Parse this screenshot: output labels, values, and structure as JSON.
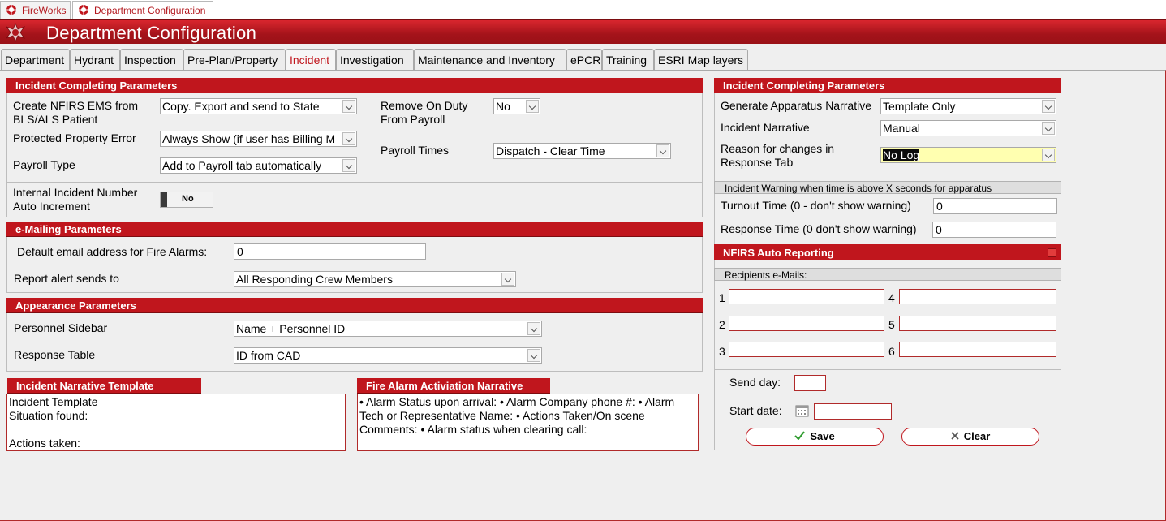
{
  "doc_tabs": [
    {
      "label": "FireWorks"
    },
    {
      "label": "Department Configuration"
    }
  ],
  "header": {
    "title": "Department Configuration"
  },
  "tabs": [
    {
      "label": "Department"
    },
    {
      "label": "Hydrant"
    },
    {
      "label": "Inspection"
    },
    {
      "label": "Pre-Plan/Property"
    },
    {
      "label": "Incident"
    },
    {
      "label": "Investigation"
    },
    {
      "label": "Maintenance and Inventory"
    },
    {
      "label": "ePCR"
    },
    {
      "label": "Training"
    },
    {
      "label": "ESRI Map layers"
    }
  ],
  "incident_params": {
    "title": "Incident Completing Parameters",
    "nfirs_ems_label": "Create NFIRS EMS from BLS/ALS Patient",
    "nfirs_ems_value": "Copy. Export and send to State",
    "protected_label": "Protected Property Error",
    "protected_value": "Always Show (if user has Billing M",
    "payroll_type_label": "Payroll Type",
    "payroll_type_value": "Add to Payroll tab automatically",
    "remove_on_duty_label": "Remove On Duty From Payroll",
    "remove_on_duty_value": "No",
    "payroll_times_label": "Payroll Times",
    "payroll_times_value": "Dispatch - Clear Time",
    "internal_number_label": "Internal Incident Number Auto Increment",
    "internal_number_value": "No"
  },
  "email_params": {
    "title": "e-Mailing Parameters",
    "default_email_label": "Default email address for Fire Alarms:",
    "default_email_value": "0",
    "report_alert_label": "Report alert sends to",
    "report_alert_value": "All Responding Crew Members"
  },
  "appearance_params": {
    "title": "Appearance Parameters",
    "sidebar_label": "Personnel Sidebar",
    "sidebar_value": "Name + Personnel ID",
    "response_table_label": "Response Table",
    "response_table_value": "ID from CAD"
  },
  "narrative_template": {
    "title": "Incident Narrative Template",
    "text": "Incident Template\nSituation found:\n\nActions taken:"
  },
  "fire_alarm_narrative": {
    "title": "Fire Alarm Activiation Narrative",
    "text": "• Alarm Status upon arrival: • Alarm Company phone #: • Alarm Tech or Representative Name: • Actions Taken/On scene Comments: • Alarm status when clearing call:"
  },
  "right_params": {
    "title": "Incident Completing Parameters",
    "apparatus_narrative_label": "Generate Apparatus Narrative",
    "apparatus_narrative_value": "Template Only",
    "incident_narrative_label": "Incident Narrative",
    "incident_narrative_value": "Manual",
    "reason_label": "Reason for changes in Response Tab",
    "reason_value": "No Log",
    "warning_title": "Incident Warning when time is above X seconds for apparatus",
    "turnout_label": "Turnout Time  (0 - don't show warning)",
    "turnout_value": "0",
    "response_time_label": "Response Time (0 don't show warning)",
    "response_time_value": "0"
  },
  "nfirs_auto": {
    "title": "NFIRS Auto Reporting",
    "recipients_title": "Recipients e-Mails:",
    "numbers": [
      "1",
      "2",
      "3",
      "4",
      "5",
      "6"
    ],
    "send_day_label": "Send day:",
    "send_day_value": "",
    "start_date_label": "Start date:",
    "start_date_value": "",
    "save_label": "Save",
    "clear_label": "Clear"
  },
  "colors": {
    "accent": "#c0161d",
    "highlight": "#ffffb0"
  }
}
